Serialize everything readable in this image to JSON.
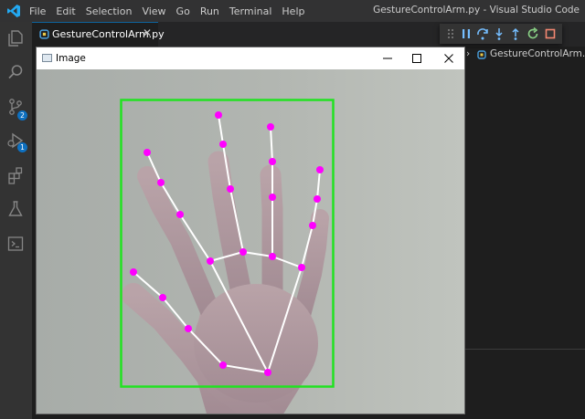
{
  "app": {
    "window_title": "GestureControlArm.py - Visual Studio Code",
    "menu": [
      "File",
      "Edit",
      "Selection",
      "View",
      "Go",
      "Run",
      "Terminal",
      "Help"
    ]
  },
  "activity_bar": {
    "items": [
      {
        "name": "explorer-icon"
      },
      {
        "name": "search-icon"
      },
      {
        "name": "source-control-icon",
        "badge": "2"
      },
      {
        "name": "run-debug-icon",
        "badge": "1"
      },
      {
        "name": "extensions-icon"
      },
      {
        "name": "testing-icon"
      },
      {
        "name": "remote-explorer-icon"
      }
    ]
  },
  "editor": {
    "tab": {
      "label": "GestureControlArm.py",
      "close": "✕",
      "icon": "python-file-icon"
    },
    "breadcrumb": {
      "separator": "›",
      "file": "GestureControlArm.py"
    }
  },
  "debug_toolbar": {
    "buttons": [
      "grip-icon",
      "pause-icon",
      "step-over-icon",
      "step-into-icon",
      "step-out-icon",
      "restart-icon",
      "stop-icon"
    ]
  },
  "image_window": {
    "title": "Image",
    "controls": [
      "minimize-icon",
      "maximize-icon",
      "close-icon"
    ]
  },
  "colors": {
    "titlebar": "#323233",
    "activity_bar": "#333333",
    "editor": "#1e1e1e",
    "badge": "#0e70c0",
    "bounding_box": "#21e221",
    "landmark": "#ff00ff",
    "skeleton": "#ffffff"
  }
}
